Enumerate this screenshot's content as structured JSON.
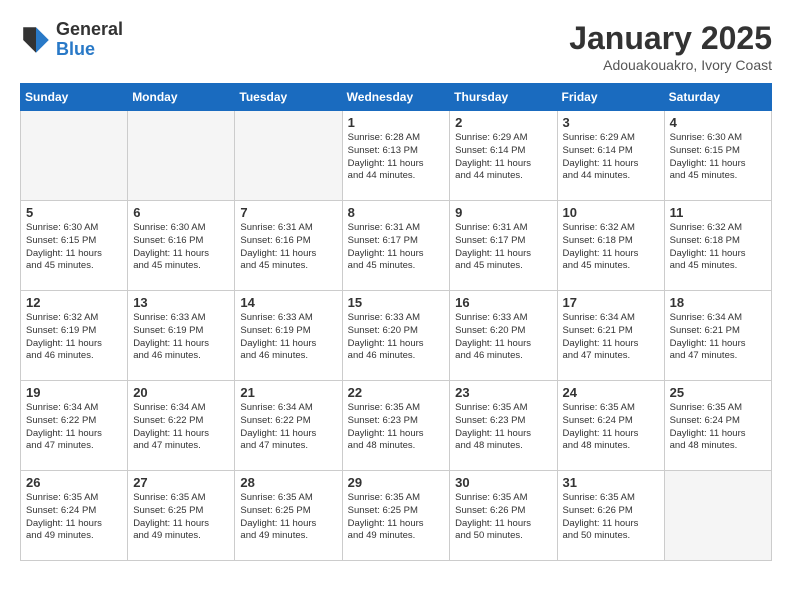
{
  "logo": {
    "general": "General",
    "blue": "Blue"
  },
  "title": "January 2025",
  "subtitle": "Adouakouakro, Ivory Coast",
  "headers": [
    "Sunday",
    "Monday",
    "Tuesday",
    "Wednesday",
    "Thursday",
    "Friday",
    "Saturday"
  ],
  "weeks": [
    [
      {
        "day": "",
        "info": ""
      },
      {
        "day": "",
        "info": ""
      },
      {
        "day": "",
        "info": ""
      },
      {
        "day": "1",
        "info": "Sunrise: 6:28 AM\nSunset: 6:13 PM\nDaylight: 11 hours\nand 44 minutes."
      },
      {
        "day": "2",
        "info": "Sunrise: 6:29 AM\nSunset: 6:14 PM\nDaylight: 11 hours\nand 44 minutes."
      },
      {
        "day": "3",
        "info": "Sunrise: 6:29 AM\nSunset: 6:14 PM\nDaylight: 11 hours\nand 44 minutes."
      },
      {
        "day": "4",
        "info": "Sunrise: 6:30 AM\nSunset: 6:15 PM\nDaylight: 11 hours\nand 45 minutes."
      }
    ],
    [
      {
        "day": "5",
        "info": "Sunrise: 6:30 AM\nSunset: 6:15 PM\nDaylight: 11 hours\nand 45 minutes."
      },
      {
        "day": "6",
        "info": "Sunrise: 6:30 AM\nSunset: 6:16 PM\nDaylight: 11 hours\nand 45 minutes."
      },
      {
        "day": "7",
        "info": "Sunrise: 6:31 AM\nSunset: 6:16 PM\nDaylight: 11 hours\nand 45 minutes."
      },
      {
        "day": "8",
        "info": "Sunrise: 6:31 AM\nSunset: 6:17 PM\nDaylight: 11 hours\nand 45 minutes."
      },
      {
        "day": "9",
        "info": "Sunrise: 6:31 AM\nSunset: 6:17 PM\nDaylight: 11 hours\nand 45 minutes."
      },
      {
        "day": "10",
        "info": "Sunrise: 6:32 AM\nSunset: 6:18 PM\nDaylight: 11 hours\nand 45 minutes."
      },
      {
        "day": "11",
        "info": "Sunrise: 6:32 AM\nSunset: 6:18 PM\nDaylight: 11 hours\nand 45 minutes."
      }
    ],
    [
      {
        "day": "12",
        "info": "Sunrise: 6:32 AM\nSunset: 6:19 PM\nDaylight: 11 hours\nand 46 minutes."
      },
      {
        "day": "13",
        "info": "Sunrise: 6:33 AM\nSunset: 6:19 PM\nDaylight: 11 hours\nand 46 minutes."
      },
      {
        "day": "14",
        "info": "Sunrise: 6:33 AM\nSunset: 6:19 PM\nDaylight: 11 hours\nand 46 minutes."
      },
      {
        "day": "15",
        "info": "Sunrise: 6:33 AM\nSunset: 6:20 PM\nDaylight: 11 hours\nand 46 minutes."
      },
      {
        "day": "16",
        "info": "Sunrise: 6:33 AM\nSunset: 6:20 PM\nDaylight: 11 hours\nand 46 minutes."
      },
      {
        "day": "17",
        "info": "Sunrise: 6:34 AM\nSunset: 6:21 PM\nDaylight: 11 hours\nand 47 minutes."
      },
      {
        "day": "18",
        "info": "Sunrise: 6:34 AM\nSunset: 6:21 PM\nDaylight: 11 hours\nand 47 minutes."
      }
    ],
    [
      {
        "day": "19",
        "info": "Sunrise: 6:34 AM\nSunset: 6:22 PM\nDaylight: 11 hours\nand 47 minutes."
      },
      {
        "day": "20",
        "info": "Sunrise: 6:34 AM\nSunset: 6:22 PM\nDaylight: 11 hours\nand 47 minutes."
      },
      {
        "day": "21",
        "info": "Sunrise: 6:34 AM\nSunset: 6:22 PM\nDaylight: 11 hours\nand 47 minutes."
      },
      {
        "day": "22",
        "info": "Sunrise: 6:35 AM\nSunset: 6:23 PM\nDaylight: 11 hours\nand 48 minutes."
      },
      {
        "day": "23",
        "info": "Sunrise: 6:35 AM\nSunset: 6:23 PM\nDaylight: 11 hours\nand 48 minutes."
      },
      {
        "day": "24",
        "info": "Sunrise: 6:35 AM\nSunset: 6:24 PM\nDaylight: 11 hours\nand 48 minutes."
      },
      {
        "day": "25",
        "info": "Sunrise: 6:35 AM\nSunset: 6:24 PM\nDaylight: 11 hours\nand 48 minutes."
      }
    ],
    [
      {
        "day": "26",
        "info": "Sunrise: 6:35 AM\nSunset: 6:24 PM\nDaylight: 11 hours\nand 49 minutes."
      },
      {
        "day": "27",
        "info": "Sunrise: 6:35 AM\nSunset: 6:25 PM\nDaylight: 11 hours\nand 49 minutes."
      },
      {
        "day": "28",
        "info": "Sunrise: 6:35 AM\nSunset: 6:25 PM\nDaylight: 11 hours\nand 49 minutes."
      },
      {
        "day": "29",
        "info": "Sunrise: 6:35 AM\nSunset: 6:25 PM\nDaylight: 11 hours\nand 49 minutes."
      },
      {
        "day": "30",
        "info": "Sunrise: 6:35 AM\nSunset: 6:26 PM\nDaylight: 11 hours\nand 50 minutes."
      },
      {
        "day": "31",
        "info": "Sunrise: 6:35 AM\nSunset: 6:26 PM\nDaylight: 11 hours\nand 50 minutes."
      },
      {
        "day": "",
        "info": ""
      }
    ]
  ]
}
